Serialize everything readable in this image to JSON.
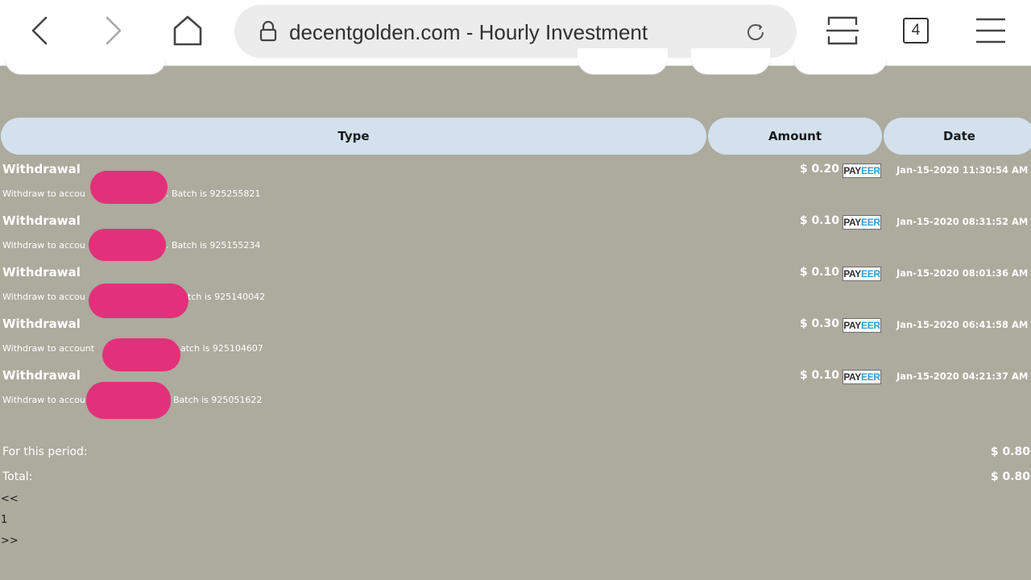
{
  "browser": {
    "url_text": "decentgolden.com - Hourly Investment",
    "tab_count": "4",
    "icons": [
      "back-icon",
      "forward-icon",
      "home-icon",
      "lock-icon",
      "reload-icon",
      "tabs-layout-icon",
      "menu-icon"
    ]
  },
  "table": {
    "headers": {
      "type": "Type",
      "amount": "Amount",
      "date": "Date"
    },
    "rows": [
      {
        "type": "Withdrawal",
        "desc_left": "Withdraw to accou",
        "desc_right": ". Batch is 925255821",
        "amount": "$ 0.20",
        "gateway_p1": "PAY",
        "gateway_p2": "EER",
        "date": "Jan-15-2020 11:30:54 AM"
      },
      {
        "type": "Withdrawal",
        "desc_left": "Withdraw to accou",
        "desc_right": ". Batch is 925155234",
        "amount": "$ 0.10",
        "gateway_p1": "PAY",
        "gateway_p2": "EER",
        "date": "Jan-15-2020 08:31:52 AM"
      },
      {
        "type": "Withdrawal",
        "desc_left": "Withdraw to accou",
        "desc_right": "tch is 925140042",
        "amount": "$ 0.10",
        "gateway_p1": "PAY",
        "gateway_p2": "EER",
        "date": "Jan-15-2020 08:01:36 AM"
      },
      {
        "type": "Withdrawal",
        "desc_left": "Withdraw to account",
        "desc_right": "atch is 925104607",
        "amount": "$ 0.30",
        "gateway_p1": "PAY",
        "gateway_p2": "EER",
        "date": "Jan-15-2020 06:41:58 AM"
      },
      {
        "type": "Withdrawal",
        "desc_left": "Withdraw to accou",
        "desc_right": "Batch is 925051622",
        "amount": "$ 0.10",
        "gateway_p1": "PAY",
        "gateway_p2": "EER",
        "date": "Jan-15-2020 04:21:37 AM"
      }
    ]
  },
  "summary": {
    "period_label": "For this period:",
    "period_value": "$ 0.80",
    "total_label": "Total:",
    "total_value": "$ 0.80"
  },
  "pagination": {
    "prev": "<<",
    "current": "1",
    "next": ">>"
  },
  "colors": {
    "page_bg": "#adaa9e",
    "header_bg": "#d3e1ee",
    "redaction": "#e3307a",
    "payeer_blue": "#2a9fd8"
  }
}
